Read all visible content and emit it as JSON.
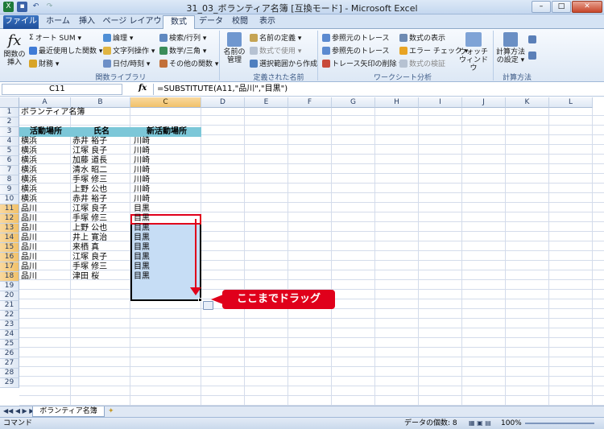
{
  "window": {
    "title": "31_03_ボランティア名簿 [互換モード] - Microsoft Excel",
    "minimize": "–",
    "restore": "□",
    "close": "✕"
  },
  "ribbon_tabs": [
    "ファイル",
    "ホーム",
    "挿入",
    "ページ レイアウト",
    "数式",
    "データ",
    "校閲",
    "表示"
  ],
  "ribbon": {
    "insert_function": "関数の挿入",
    "autosum": "オート SUM ▾",
    "recent": "最近使用した関数 ▾",
    "financial": "財務 ▾",
    "logical": "論理 ▾",
    "text": "文字列操作 ▾",
    "datetime": "日付/時刻 ▾",
    "lookup": "検索/行列 ▾",
    "math": "数学/三角 ▾",
    "other": "その他の関数 ▾",
    "group_library": "関数ライブラリ",
    "name_manager": "名前の管理",
    "define_name": "名前の定義 ▾",
    "use_in_formula": "数式で使用 ▾",
    "create_from_selection": "選択範囲から作成",
    "group_names": "定義された名前",
    "trace_precedents": "参照元のトレース",
    "trace_dependents": "参照先のトレース",
    "remove_arrows": "トレース矢印の削除 ▾",
    "show_formulas": "数式の表示",
    "error_checking": "エラー チェック ▾",
    "evaluate": "数式の検証",
    "watch_window": "ウォッチ ウィンドウ",
    "group_audit": "ワークシート分析",
    "calc_options": "計算方法の設定 ▾",
    "group_calc": "計算方法"
  },
  "formula_bar": {
    "name_box": "C11",
    "fx": "fx",
    "formula": "=SUBSTITUTE(A11,\"品川\",\"目黒\")"
  },
  "columns": [
    "A",
    "B",
    "C",
    "D",
    "E",
    "F",
    "G",
    "H",
    "I",
    "J",
    "K",
    "L"
  ],
  "rows": [
    "1",
    "2",
    "3",
    "4",
    "5",
    "6",
    "7",
    "8",
    "9",
    "10",
    "11",
    "12",
    "13",
    "14",
    "15",
    "16",
    "17",
    "18",
    "19",
    "20",
    "21",
    "22",
    "23",
    "24",
    "25",
    "26",
    "27",
    "28",
    "29"
  ],
  "sheet": {
    "title": "ボランティア名簿",
    "headers": [
      "活動場所",
      "氏名",
      "新活動場所"
    ],
    "data": [
      [
        "横浜",
        "赤井 裕子",
        "川崎"
      ],
      [
        "横浜",
        "江塚 良子",
        "川崎"
      ],
      [
        "横浜",
        "加藤 道長",
        "川崎"
      ],
      [
        "横浜",
        "清水 昭二",
        "川崎"
      ],
      [
        "横浜",
        "手塚 修三",
        "川崎"
      ],
      [
        "横浜",
        "上野 公也",
        "川崎"
      ],
      [
        "横浜",
        "赤井 裕子",
        "川崎"
      ],
      [
        "品川",
        "江塚 良子",
        "目黒"
      ],
      [
        "品川",
        "手塚 修三",
        "目黒"
      ],
      [
        "品川",
        "上野 公也",
        "目黒"
      ],
      [
        "品川",
        "井上 寛治",
        "目黒"
      ],
      [
        "品川",
        "来栖 真",
        "目黒"
      ],
      [
        "品川",
        "江塚 良子",
        "目黒"
      ],
      [
        "品川",
        "手塚 修三",
        "目黒"
      ],
      [
        "品川",
        "津田 桜",
        "目黒"
      ]
    ]
  },
  "callout": "ここまでドラッグ",
  "sheet_tab": "ボランティア名簿",
  "status": {
    "mode": "コマンド",
    "count": "データの個数: 8",
    "zoom": "100%"
  }
}
